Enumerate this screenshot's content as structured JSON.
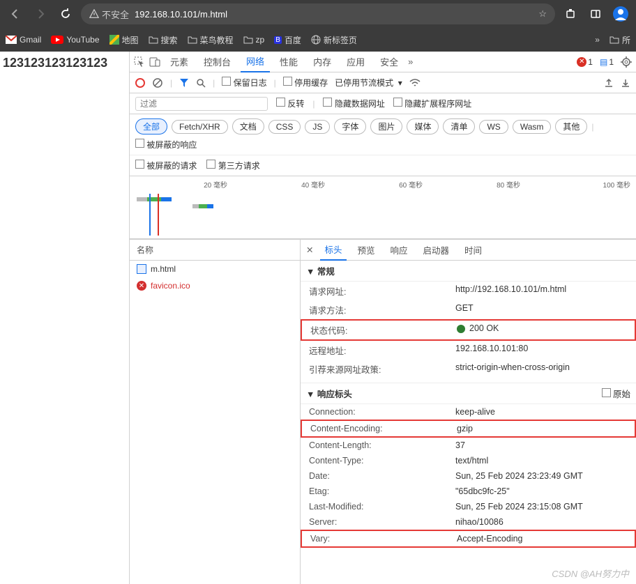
{
  "browser": {
    "secure_label": "不安全",
    "url": "192.168.10.101/m.html",
    "bookmarks": [
      "Gmail",
      "YouTube",
      "地图",
      "搜索",
      "菜鸟教程",
      "zp",
      "百度",
      "新标签页",
      "所"
    ]
  },
  "page": {
    "body_text": "123123123123123"
  },
  "devtools": {
    "tabs": [
      "元素",
      "控制台",
      "网络",
      "性能",
      "内存",
      "应用",
      "安全"
    ],
    "active_tab": "网络",
    "error_count": "1",
    "info_count": "1",
    "toolbar": {
      "preserve_log": "保留日志",
      "disable_cache": "停用缓存",
      "throttle_label": "已停用节流模式"
    },
    "filter": {
      "placeholder": "过滤",
      "invert": "反转",
      "hide_data_url": "隐藏数据网址",
      "hide_ext_url": "隐藏扩展程序网址"
    },
    "types": [
      "全部",
      "Fetch/XHR",
      "文档",
      "CSS",
      "JS",
      "字体",
      "图片",
      "媒体",
      "清单",
      "WS",
      "Wasm",
      "其他"
    ],
    "type_extra": "被屏蔽的响应",
    "extra_row": [
      "被屏蔽的请求",
      "第三方请求"
    ],
    "timeline": {
      "t1": "20 毫秒",
      "t2": "40 毫秒",
      "t3": "60 毫秒",
      "t4": "80 毫秒",
      "t5": "100 毫秒"
    },
    "reqlist": {
      "header": "名称",
      "items": [
        {
          "name": "m.html",
          "type": "doc"
        },
        {
          "name": "favicon.ico",
          "type": "error"
        }
      ]
    },
    "detail_tabs": [
      "标头",
      "预览",
      "响应",
      "启动器",
      "时间"
    ],
    "general": {
      "title": "常规",
      "rows": [
        {
          "k": "请求网址:",
          "v": "http://192.168.10.101/m.html"
        },
        {
          "k": "请求方法:",
          "v": "GET"
        },
        {
          "k": "状态代码:",
          "v": "200 OK",
          "status": true,
          "hl": true
        },
        {
          "k": "远程地址:",
          "v": "192.168.10.101:80"
        },
        {
          "k": "引荐来源网址政策:",
          "v": "strict-origin-when-cross-origin"
        }
      ]
    },
    "response_headers": {
      "title": "响应标头",
      "raw_label": "原始",
      "rows": [
        {
          "k": "Connection:",
          "v": "keep-alive"
        },
        {
          "k": "Content-Encoding:",
          "v": "gzip",
          "hl": true
        },
        {
          "k": "Content-Length:",
          "v": "37"
        },
        {
          "k": "Content-Type:",
          "v": "text/html"
        },
        {
          "k": "Date:",
          "v": "Sun, 25 Feb 2024 23:23:49 GMT"
        },
        {
          "k": "Etag:",
          "v": "\"65dbc9fc-25\""
        },
        {
          "k": "Last-Modified:",
          "v": "Sun, 25 Feb 2024 23:15:08 GMT"
        },
        {
          "k": "Server:",
          "v": "nihao/10086"
        },
        {
          "k": "Vary:",
          "v": "Accept-Encoding",
          "hl": true
        }
      ]
    }
  },
  "watermark": "CSDN @AH努力中"
}
